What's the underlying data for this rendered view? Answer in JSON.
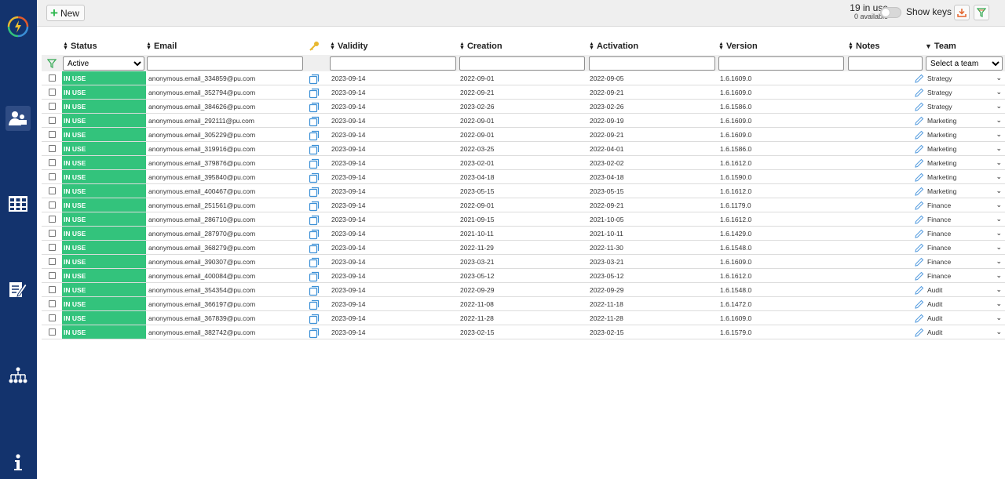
{
  "sidebar": {
    "icons": [
      "logo-icon",
      "users-icon",
      "grid-icon",
      "notes-edit-icon",
      "hierarchy-icon",
      "info-icon"
    ]
  },
  "toolbar": {
    "new_label": "New",
    "in_use": "19 in use",
    "available": "0 available",
    "show_keys_label": "Show keys",
    "download_icon": "download-icon",
    "filter_icon": "filter-icon"
  },
  "table": {
    "headers": {
      "status": "Status",
      "email": "Email",
      "validity": "Validity",
      "creation": "Creation",
      "activation": "Activation",
      "version": "Version",
      "notes": "Notes",
      "team": "Team"
    },
    "filters": {
      "status_value": "Active",
      "team_placeholder": "Select a team"
    },
    "rows": [
      {
        "status": "IN USE",
        "email": "anonymous.email_334859@pu.com",
        "validity": "2023-09-14",
        "creation": "2022-09-01",
        "activation": "2022-09-05",
        "version": "1.6.1609.0",
        "team": "Strategy"
      },
      {
        "status": "IN USE",
        "email": "anonymous.email_352794@pu.com",
        "validity": "2023-09-14",
        "creation": "2022-09-21",
        "activation": "2022-09-21",
        "version": "1.6.1609.0",
        "team": "Strategy"
      },
      {
        "status": "IN USE",
        "email": "anonymous.email_384626@pu.com",
        "validity": "2023-09-14",
        "creation": "2023-02-26",
        "activation": "2023-02-26",
        "version": "1.6.1586.0",
        "team": "Strategy"
      },
      {
        "status": "IN USE",
        "email": "anonymous.email_292111@pu.com",
        "validity": "2023-09-14",
        "creation": "2022-09-01",
        "activation": "2022-09-19",
        "version": "1.6.1609.0",
        "team": "Marketing"
      },
      {
        "status": "IN USE",
        "email": "anonymous.email_305229@pu.com",
        "validity": "2023-09-14",
        "creation": "2022-09-01",
        "activation": "2022-09-21",
        "version": "1.6.1609.0",
        "team": "Marketing"
      },
      {
        "status": "IN USE",
        "email": "anonymous.email_319916@pu.com",
        "validity": "2023-09-14",
        "creation": "2022-03-25",
        "activation": "2022-04-01",
        "version": "1.6.1586.0",
        "team": "Marketing"
      },
      {
        "status": "IN USE",
        "email": "anonymous.email_379876@pu.com",
        "validity": "2023-09-14",
        "creation": "2023-02-01",
        "activation": "2023-02-02",
        "version": "1.6.1612.0",
        "team": "Marketing"
      },
      {
        "status": "IN USE",
        "email": "anonymous.email_395840@pu.com",
        "validity": "2023-09-14",
        "creation": "2023-04-18",
        "activation": "2023-04-18",
        "version": "1.6.1590.0",
        "team": "Marketing"
      },
      {
        "status": "IN USE",
        "email": "anonymous.email_400467@pu.com",
        "validity": "2023-09-14",
        "creation": "2023-05-15",
        "activation": "2023-05-15",
        "version": "1.6.1612.0",
        "team": "Marketing"
      },
      {
        "status": "IN USE",
        "email": "anonymous.email_251561@pu.com",
        "validity": "2023-09-14",
        "creation": "2022-09-01",
        "activation": "2022-09-21",
        "version": "1.6.1179.0",
        "team": "Finance"
      },
      {
        "status": "IN USE",
        "email": "anonymous.email_286710@pu.com",
        "validity": "2023-09-14",
        "creation": "2021-09-15",
        "activation": "2021-10-05",
        "version": "1.6.1612.0",
        "team": "Finance"
      },
      {
        "status": "IN USE",
        "email": "anonymous.email_287970@pu.com",
        "validity": "2023-09-14",
        "creation": "2021-10-11",
        "activation": "2021-10-11",
        "version": "1.6.1429.0",
        "team": "Finance"
      },
      {
        "status": "IN USE",
        "email": "anonymous.email_368279@pu.com",
        "validity": "2023-09-14",
        "creation": "2022-11-29",
        "activation": "2022-11-30",
        "version": "1.6.1548.0",
        "team": "Finance"
      },
      {
        "status": "IN USE",
        "email": "anonymous.email_390307@pu.com",
        "validity": "2023-09-14",
        "creation": "2023-03-21",
        "activation": "2023-03-21",
        "version": "1.6.1609.0",
        "team": "Finance"
      },
      {
        "status": "IN USE",
        "email": "anonymous.email_400084@pu.com",
        "validity": "2023-09-14",
        "creation": "2023-05-12",
        "activation": "2023-05-12",
        "version": "1.6.1612.0",
        "team": "Finance"
      },
      {
        "status": "IN USE",
        "email": "anonymous.email_354354@pu.com",
        "validity": "2023-09-14",
        "creation": "2022-09-29",
        "activation": "2022-09-29",
        "version": "1.6.1548.0",
        "team": "Audit"
      },
      {
        "status": "IN USE",
        "email": "anonymous.email_366197@pu.com",
        "validity": "2023-09-14",
        "creation": "2022-11-08",
        "activation": "2022-11-18",
        "version": "1.6.1472.0",
        "team": "Audit"
      },
      {
        "status": "IN USE",
        "email": "anonymous.email_367839@pu.com",
        "validity": "2023-09-14",
        "creation": "2022-11-28",
        "activation": "2022-11-28",
        "version": "1.6.1609.0",
        "team": "Audit"
      },
      {
        "status": "IN USE",
        "email": "anonymous.email_382742@pu.com",
        "validity": "2023-09-14",
        "creation": "2023-02-15",
        "activation": "2023-02-15",
        "version": "1.6.1579.0",
        "team": "Audit"
      }
    ]
  },
  "colors": {
    "sidebar": "#13336d",
    "status_in_use": "#33c37c",
    "key_icon": "#e8b830",
    "copy_icon": "#3a8fd6",
    "edit_icon": "#5a9fe0",
    "download_accent": "#e3632a",
    "filter_accent": "#33a852"
  }
}
